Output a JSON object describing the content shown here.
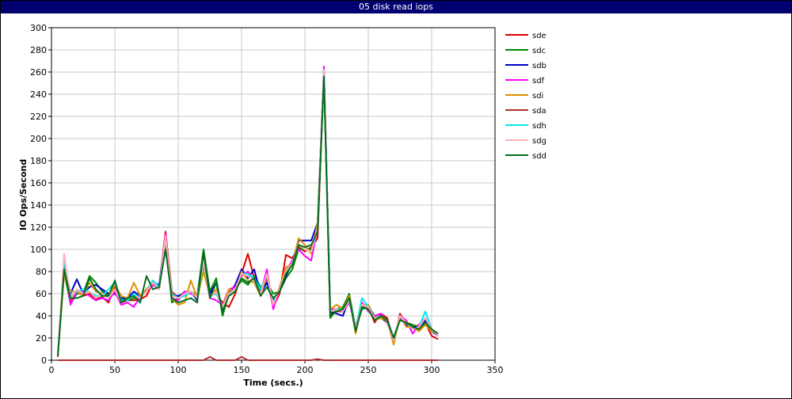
{
  "chart_data": {
    "type": "line",
    "title": "05 disk read iops",
    "xlabel": "Time (secs.)",
    "ylabel": "IO Ops/Second",
    "xlim": [
      0,
      350
    ],
    "ylim": [
      0,
      300
    ],
    "xticks": [
      0,
      50,
      100,
      150,
      200,
      250,
      300,
      350
    ],
    "yticks": [
      0,
      20,
      40,
      60,
      80,
      100,
      120,
      140,
      160,
      180,
      200,
      220,
      240,
      260,
      280,
      300
    ],
    "grid": true,
    "legend_position": "right",
    "x": [
      5,
      10,
      15,
      20,
      25,
      30,
      35,
      40,
      45,
      50,
      55,
      60,
      65,
      70,
      75,
      80,
      85,
      90,
      95,
      100,
      105,
      110,
      115,
      120,
      125,
      130,
      135,
      140,
      145,
      150,
      155,
      160,
      165,
      170,
      175,
      180,
      185,
      190,
      195,
      200,
      205,
      210,
      215,
      220,
      225,
      230,
      235,
      240,
      245,
      250,
      255,
      260,
      265,
      270,
      275,
      280,
      285,
      290,
      295,
      300,
      305
    ],
    "series": [
      {
        "name": "sde",
        "color": "#e00000",
        "values": [
          3,
          86,
          52,
          62,
          58,
          60,
          55,
          57,
          52,
          66,
          52,
          54,
          54,
          55,
          58,
          70,
          66,
          116,
          62,
          56,
          62,
          60,
          58,
          93,
          58,
          60,
          52,
          48,
          60,
          78,
          96,
          74,
          62,
          74,
          48,
          60,
          95,
          92,
          102,
          98,
          102,
          110,
          260,
          42,
          44,
          44,
          54,
          30,
          48,
          48,
          34,
          42,
          38,
          16,
          42,
          32,
          28,
          32,
          34,
          22,
          19
        ]
      },
      {
        "name": "sdc",
        "color": "#008800",
        "values": [
          5,
          80,
          51,
          60,
          60,
          76,
          70,
          62,
          58,
          60,
          56,
          54,
          56,
          56,
          62,
          70,
          65,
          108,
          52,
          56,
          60,
          62,
          58,
          100,
          62,
          74,
          40,
          60,
          64,
          72,
          68,
          76,
          66,
          70,
          60,
          62,
          74,
          82,
          100,
          100,
          100,
          118,
          258,
          38,
          46,
          48,
          60,
          28,
          46,
          48,
          40,
          38,
          34,
          18,
          40,
          34,
          32,
          30,
          34,
          28,
          24
        ]
      },
      {
        "name": "sdb",
        "color": "#0000cc",
        "values": [
          4,
          88,
          60,
          73,
          60,
          66,
          68,
          64,
          60,
          60,
          56,
          56,
          62,
          58,
          64,
          70,
          68,
          112,
          58,
          58,
          60,
          62,
          54,
          90,
          60,
          70,
          44,
          60,
          68,
          82,
          74,
          82,
          60,
          70,
          54,
          62,
          76,
          88,
          108,
          108,
          108,
          124,
          262,
          44,
          42,
          40,
          56,
          26,
          50,
          50,
          38,
          40,
          36,
          20,
          38,
          32,
          30,
          30,
          36,
          26,
          22
        ]
      },
      {
        "name": "sdf",
        "color": "#ff00ff",
        "values": [
          4,
          92,
          50,
          62,
          62,
          58,
          54,
          56,
          54,
          62,
          50,
          52,
          48,
          58,
          62,
          68,
          64,
          114,
          56,
          54,
          62,
          60,
          58,
          86,
          56,
          54,
          50,
          64,
          66,
          76,
          80,
          72,
          60,
          82,
          46,
          64,
          80,
          90,
          100,
          94,
          90,
          120,
          265,
          46,
          46,
          44,
          52,
          30,
          52,
          44,
          40,
          42,
          34,
          18,
          40,
          36,
          24,
          32,
          38,
          28,
          22
        ]
      },
      {
        "name": "sdi",
        "color": "#e09000",
        "values": [
          4,
          78,
          62,
          62,
          58,
          70,
          62,
          60,
          56,
          68,
          58,
          56,
          70,
          58,
          64,
          70,
          64,
          110,
          56,
          50,
          52,
          72,
          56,
          80,
          58,
          64,
          48,
          64,
          62,
          80,
          72,
          70,
          58,
          78,
          50,
          66,
          84,
          86,
          110,
          104,
          96,
          124,
          255,
          46,
          50,
          46,
          58,
          24,
          50,
          50,
          36,
          38,
          36,
          14,
          40,
          30,
          30,
          26,
          32,
          26,
          24
        ]
      },
      {
        "name": "sda",
        "color": "#b03030",
        "values": [
          0,
          0,
          0,
          0,
          0,
          0,
          0,
          0,
          0,
          0,
          0,
          0,
          0,
          0,
          0,
          0,
          0,
          0,
          0,
          0,
          0,
          0,
          0,
          0,
          3,
          0,
          0,
          0,
          0,
          3,
          0,
          0,
          0,
          0,
          0,
          0,
          0,
          0,
          0,
          0,
          0,
          1,
          0,
          0,
          0,
          0,
          0,
          0,
          0,
          0,
          0,
          0,
          0,
          0,
          0,
          0,
          0,
          0,
          0,
          0,
          0
        ]
      },
      {
        "name": "sdh",
        "color": "#00e8f0",
        "values": [
          4,
          90,
          58,
          62,
          64,
          62,
          58,
          58,
          64,
          70,
          54,
          54,
          60,
          56,
          62,
          72,
          66,
          110,
          60,
          56,
          58,
          62,
          56,
          88,
          58,
          60,
          48,
          60,
          64,
          78,
          78,
          74,
          64,
          76,
          52,
          64,
          78,
          86,
          104,
          100,
          98,
          118,
          262,
          44,
          46,
          46,
          56,
          28,
          56,
          48,
          36,
          40,
          36,
          18,
          40,
          34,
          28,
          30,
          44,
          28,
          24
        ]
      },
      {
        "name": "sdg",
        "color": "#ffb0b8",
        "values": [
          4,
          96,
          56,
          64,
          60,
          62,
          56,
          60,
          56,
          64,
          52,
          56,
          58,
          56,
          62,
          70,
          64,
          112,
          58,
          56,
          60,
          62,
          56,
          90,
          56,
          62,
          48,
          60,
          64,
          78,
          76,
          72,
          60,
          78,
          50,
          64,
          80,
          88,
          104,
          100,
          98,
          120,
          262,
          44,
          46,
          44,
          54,
          28,
          50,
          48,
          38,
          40,
          36,
          18,
          40,
          34,
          28,
          30,
          38,
          28,
          22
        ]
      },
      {
        "name": "sdd",
        "color": "#006e1e",
        "values": [
          4,
          82,
          56,
          56,
          58,
          74,
          64,
          58,
          58,
          72,
          52,
          56,
          58,
          52,
          76,
          64,
          66,
          100,
          56,
          52,
          54,
          56,
          52,
          98,
          56,
          70,
          44,
          58,
          62,
          74,
          70,
          74,
          58,
          66,
          56,
          62,
          78,
          86,
          104,
          102,
          104,
          116,
          256,
          40,
          44,
          46,
          56,
          26,
          48,
          46,
          36,
          40,
          36,
          20,
          36,
          34,
          30,
          28,
          34,
          28,
          24
        ]
      }
    ]
  }
}
